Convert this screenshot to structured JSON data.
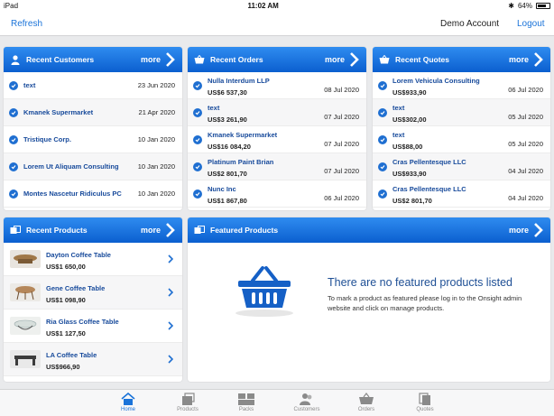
{
  "status": {
    "device": "iPad",
    "time": "11:02 AM",
    "battery": "64%"
  },
  "nav": {
    "refresh": "Refresh",
    "account": "Demo Account",
    "logout": "Logout"
  },
  "more_label": "more",
  "customers": {
    "title": "Recent Customers",
    "rows": [
      {
        "name": "text",
        "date": "23 Jun 2020"
      },
      {
        "name": "Kmanek Supermarket",
        "date": "21 Apr 2020"
      },
      {
        "name": "Tristique Corp.",
        "date": "10 Jan 2020"
      },
      {
        "name": "Lorem Ut Aliquam Consulting",
        "date": "10 Jan 2020"
      },
      {
        "name": "Montes Nascetur Ridiculus PC",
        "date": "10 Jan 2020"
      }
    ]
  },
  "orders": {
    "title": "Recent Orders",
    "rows": [
      {
        "name": "Nulla Interdum LLP",
        "amount": "US$6 537,30",
        "date": "08 Jul 2020"
      },
      {
        "name": "text",
        "amount": "US$3 261,90",
        "date": "07 Jul 2020"
      },
      {
        "name": "Kmanek Supermarket",
        "amount": "US$16 084,20",
        "date": "07 Jul 2020"
      },
      {
        "name": "Platinum Paint Brian",
        "amount": "US$2 801,70",
        "date": "07 Jul 2020"
      },
      {
        "name": "Nunc Inc",
        "amount": "US$1 867,80",
        "date": "06 Jul 2020"
      }
    ]
  },
  "quotes": {
    "title": "Recent Quotes",
    "rows": [
      {
        "name": "Lorem Vehicula Consulting",
        "amount": "US$933,90",
        "date": "06 Jul 2020"
      },
      {
        "name": "text",
        "amount": "US$302,00",
        "date": "05 Jul 2020"
      },
      {
        "name": "text",
        "amount": "US$88,00",
        "date": "05 Jul 2020"
      },
      {
        "name": "Cras Pellentesque LLC",
        "amount": "US$933,90",
        "date": "04 Jul 2020"
      },
      {
        "name": "Cras Pellentesque LLC",
        "amount": "US$2 801,70",
        "date": "04 Jul 2020"
      }
    ]
  },
  "products": {
    "title": "Recent Products",
    "rows": [
      {
        "name": "Dayton Coffee Table",
        "price": "US$1 650,00"
      },
      {
        "name": "Gene Coffee Table",
        "price": "US$1 098,90"
      },
      {
        "name": "Ria Glass Coffee Table",
        "price": "US$1 127,50"
      },
      {
        "name": "LA Coffee Table",
        "price": "US$966,90"
      }
    ]
  },
  "featured": {
    "title": "Featured Products",
    "empty_title": "There are no featured products listed",
    "empty_desc": "To mark a product as featured please log in to the Onsight admin website and click on manage products."
  },
  "tabs": [
    "Home",
    "Products",
    "Packs",
    "Customers",
    "Orders",
    "Quotes"
  ],
  "colors": {
    "accent": "#1a73d9",
    "header_top": "#2f8cf0",
    "header_bottom": "#0b5fcf",
    "link_text": "#174a9b"
  }
}
